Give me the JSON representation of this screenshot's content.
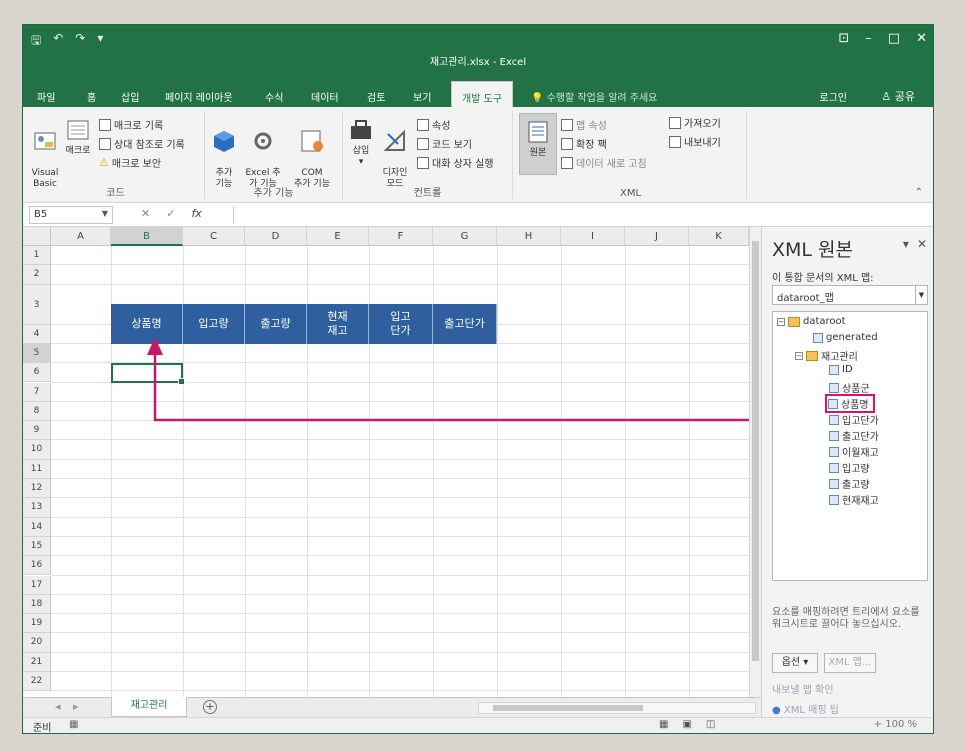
{
  "title": "재고관리.xlsx - Excel",
  "window_controls": [
    "⊡",
    "–",
    "□",
    "✕"
  ],
  "tabs": [
    "파일",
    "홈",
    "삽입",
    "페이지 레이아웃",
    "수식",
    "데이터",
    "검토",
    "보기",
    "개발 도구"
  ],
  "tell_me": "수행할 작업을 알려 주세요",
  "sign_in": "로그인",
  "share": "공유",
  "ribbon": {
    "code": {
      "label": "코드",
      "visual_basic": "Visual\nBasic",
      "macros": "매크로",
      "record_macro": "매크로 기록",
      "relative_ref": "상대 참조로 기록",
      "macro_security": "매크로 보안"
    },
    "addins": {
      "label": "추가 기능",
      "addins": "추가\n기능",
      "excel_addins": "Excel 추\n가 기능",
      "com_addins": "COM\n추가 기능"
    },
    "controls": {
      "label": "컨트롤",
      "insert": "삽입",
      "design_mode": "디자인\n모드",
      "properties": "속성",
      "view_code": "코드 보기",
      "run_dialog": "대화 상자 실행"
    },
    "xml": {
      "label": "XML",
      "source": "원본",
      "map_properties": "맵 속성",
      "expansion_packs": "확장 팩",
      "refresh_data": "데이터 새로 고침",
      "import": "가져오기",
      "export": "내보내기"
    }
  },
  "name_box": "B5",
  "fx": "fx",
  "columns": [
    "A",
    "B",
    "C",
    "D",
    "E",
    "F",
    "G",
    "H",
    "I",
    "J",
    "K"
  ],
  "rows": [
    "1",
    "2",
    "3",
    "4",
    "5",
    "6",
    "7",
    "8",
    "9",
    "10",
    "11",
    "12",
    "13",
    "14",
    "15",
    "16",
    "17",
    "18",
    "19",
    "20",
    "21",
    "22"
  ],
  "header_cells": [
    "상품명",
    "입고량",
    "출고량",
    "현재\n재고",
    "입고\n단가",
    "출고단가"
  ],
  "sheet_tab": "재고관리",
  "status_ready": "준비",
  "status_zoom": "+ 100 %",
  "xml_pane": {
    "title": "XML 원본",
    "subtitle": "이 통합 문서의 XML 맵:",
    "map": "dataroot_맵",
    "tree": {
      "root": "dataroot",
      "generated": "generated",
      "table": "재고관리",
      "fields": [
        "ID",
        "상품군",
        "상품명",
        "입고단가",
        "출고단가",
        "이월재고",
        "입고량",
        "출고량",
        "현재재고"
      ],
      "highlighted": "상품명"
    },
    "hint": "요소를 매핑하려면 트리에서 요소를 워크시트로 끌어다 놓으십시오.",
    "options_button": "옵션 ▾",
    "xml_maps_button": "XML 맵...",
    "verify_link": "내보낼 맵 확인",
    "tips_link": "XML 매핑 팁"
  },
  "colors": {
    "accent": "#217346",
    "header_fill": "#2f5f9e",
    "arrow": "#c8166c"
  }
}
